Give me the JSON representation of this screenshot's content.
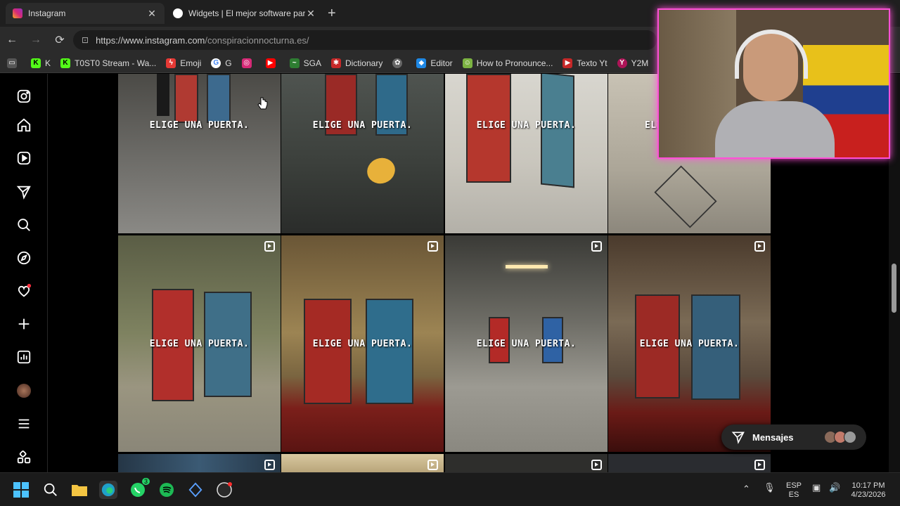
{
  "browser": {
    "tabs": [
      {
        "title": "Instagram",
        "favicon": "instagram-icon"
      },
      {
        "title": "Widgets | El mejor software para p",
        "favicon": "widgets-icon"
      }
    ],
    "url_host": "https://www.instagram.com",
    "url_path": "/conspiracionnocturna.es/",
    "bookmarks": [
      {
        "label": "K",
        "icon": "kick-icon",
        "color": "#53fc18"
      },
      {
        "label": "T0ST0 Stream - Wa...",
        "icon": "kick-icon",
        "color": "#53fc18"
      },
      {
        "label": "Emoji",
        "icon": "emoji-icon",
        "color": "#e53935"
      },
      {
        "label": "G",
        "icon": "google-icon",
        "color": "#4285f4"
      },
      {
        "label": "",
        "icon": "instagram-icon",
        "color": "#d62976"
      },
      {
        "label": "",
        "icon": "youtube-icon",
        "color": "#ff0000"
      },
      {
        "label": "SGA",
        "icon": "sga-icon",
        "color": "#2e7d32"
      },
      {
        "label": "Dictionary",
        "icon": "dictionary-icon",
        "color": "#c62828"
      },
      {
        "label": "",
        "icon": "chatgpt-icon",
        "color": "#666666"
      },
      {
        "label": "Editor",
        "icon": "editor-icon",
        "color": "#1e88e5"
      },
      {
        "label": "How to Pronounce...",
        "icon": "pronounce-icon",
        "color": "#7cb342"
      },
      {
        "label": "Texto Yt",
        "icon": "youtube-icon",
        "color": "#c62828"
      },
      {
        "label": "Y2M",
        "icon": "y2mate-icon",
        "color": "#ad1457"
      }
    ]
  },
  "sidebar": [
    "instagram-logo-icon",
    "home-icon",
    "reels-icon",
    "messages-icon",
    "search-icon",
    "explore-icon",
    "notifications-icon",
    "create-icon",
    "dashboard-icon",
    "profile-avatar",
    "menu-icon",
    "also-from-meta-icon"
  ],
  "posts": [
    {
      "label": "ELIGE UNA PUERTA."
    },
    {
      "label": "ELIGE UNA PUERTA."
    },
    {
      "label": "ELIGE UNA PUERTA."
    },
    {
      "label": "ELIGE"
    },
    {
      "label": "ELIGE UNA PUERTA."
    },
    {
      "label": "ELIGE UNA PUERTA."
    },
    {
      "label": "ELIGE UNA PUERTA."
    },
    {
      "label": "ELIGE UNA PUERTA."
    }
  ],
  "messages_button": {
    "label": "Mensajes"
  },
  "taskbar": {
    "lang_top": "ESP",
    "lang_bottom": "ES",
    "time": "10:17 PM",
    "date": "4/23/2026",
    "whatsapp_badge": "3"
  }
}
